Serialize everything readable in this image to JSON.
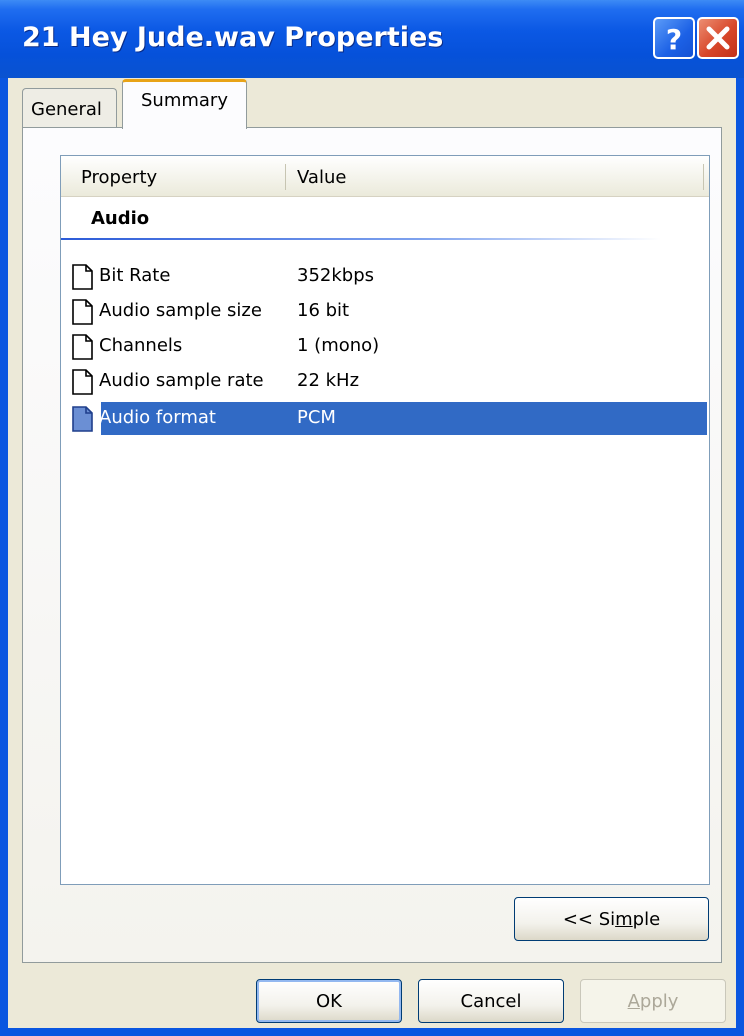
{
  "window": {
    "title": "21 Hey Jude.wav Properties"
  },
  "titlebar": {
    "help_icon": "help-icon",
    "close_icon": "close-icon"
  },
  "tabs": [
    {
      "label": "General"
    },
    {
      "label": "Summary"
    }
  ],
  "list": {
    "columns": [
      "Property",
      "Value"
    ],
    "group": "Audio",
    "rows": [
      {
        "property": "Bit Rate",
        "value": "352kbps"
      },
      {
        "property": "Audio sample size",
        "value": "16 bit"
      },
      {
        "property": "Channels",
        "value": "1 (mono)"
      },
      {
        "property": "Audio sample rate",
        "value": "22 kHz"
      },
      {
        "property": "Audio format",
        "value": "PCM"
      }
    ],
    "selected": "Audio format"
  },
  "buttons": {
    "simple": {
      "pre": "<< Si",
      "accel": "m",
      "post": "ple"
    },
    "ok": "OK",
    "cancel": "Cancel",
    "apply": {
      "accel": "A",
      "post": "pply"
    }
  },
  "colors": {
    "selection": "#316ac5",
    "titlebar": "#0a56e0",
    "tab_accent": "#e8a317"
  }
}
